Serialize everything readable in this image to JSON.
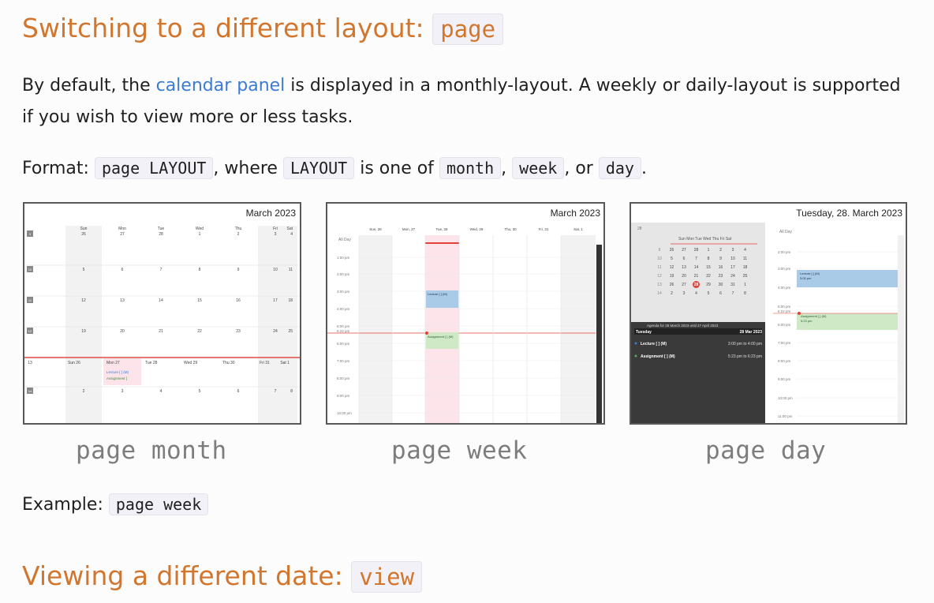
{
  "layout_section": {
    "heading_text": "Switching to a different layout:",
    "heading_code": "page"
  },
  "intro": {
    "before_link": "By default, the ",
    "link_text": "calendar panel",
    "after_link": " is displayed in a monthly-layout. A weekly or daily-layout is supported if you wish to view more or less tasks."
  },
  "format": {
    "label": "Format:",
    "command": "page LAYOUT",
    "mid1": ", where",
    "layout_word": "LAYOUT",
    "mid2": "is one of",
    "opt1": "month",
    "sep1": ",",
    "opt2": "week",
    "sep2": ", or",
    "opt3": "day",
    "end": "."
  },
  "screenshots": {
    "month": {
      "title": "March 2023",
      "caption": "page month",
      "weekdays": [
        "Sun",
        "Mon",
        "Tue",
        "Wed",
        "Thu",
        "Fri",
        "Sat"
      ],
      "weeks": [
        {
          "num": "9",
          "days": [
            "26",
            "27",
            "28",
            "1",
            "2",
            "3",
            "4"
          ]
        },
        {
          "num": "10",
          "days": [
            "5",
            "6",
            "7",
            "8",
            "9",
            "10",
            "11"
          ]
        },
        {
          "num": "11",
          "days": [
            "12",
            "13",
            "14",
            "15",
            "16",
            "17",
            "18"
          ]
        },
        {
          "num": "12",
          "days": [
            "19",
            "20",
            "21",
            "22",
            "23",
            "24",
            "25"
          ]
        },
        {
          "num": "13",
          "days": [
            "Sun 26",
            "Mon 27",
            "Tue 28",
            "Wed 29",
            "Thu 30",
            "Fri 31",
            "Sat 1"
          ]
        },
        {
          "num": "14",
          "days": [
            "2",
            "3",
            "4",
            "5",
            "6",
            "7",
            "8"
          ]
        }
      ],
      "events": [
        "Lecture [ ] (M)",
        "Assignment ["
      ]
    },
    "week": {
      "title": "March 2023",
      "caption": "page week",
      "days": [
        "Sun, 26",
        "Mon, 27",
        "Tue, 28",
        "Wed, 29",
        "Thu, 30",
        "Fri, 31",
        "Sat, 1"
      ],
      "allday": "All Day",
      "times": [
        "1:00 pm",
        "2:00 pm",
        "3:00 pm",
        "4:00 pm",
        "5:00 pm",
        "5:22 pm",
        "6:00 pm",
        "7:00 pm",
        "8:00 pm",
        "9:00 pm",
        "10:00 pm"
      ],
      "event1": "Lecture [ ] (M)",
      "event2": "Assignment [ ] (M)"
    },
    "day": {
      "title": "Tuesday, 28. March 2023",
      "caption": "page day",
      "allday": "All Day",
      "mini_month": "28",
      "mini_weekdays": "Sun Mon Tue Wed Thu Fri Sat",
      "mini_rows": [
        [
          "9",
          "26",
          "27",
          "28",
          "1",
          "2",
          "3",
          "4"
        ],
        [
          "10",
          "5",
          "6",
          "7",
          "8",
          "9",
          "10",
          "11"
        ],
        [
          "11",
          "12",
          "13",
          "14",
          "15",
          "16",
          "17",
          "18"
        ],
        [
          "12",
          "19",
          "20",
          "21",
          "22",
          "23",
          "24",
          "25"
        ],
        [
          "13",
          "26",
          "27",
          "28",
          "29",
          "30",
          "31",
          "1"
        ],
        [
          "14",
          "2",
          "3",
          "4",
          "5",
          "6",
          "7",
          "8"
        ]
      ],
      "agenda_header": "Agenda for 28 March 2023 until 27 April 2023",
      "agenda_day": "Tuesday",
      "agenda_date": "28 Mar 2023",
      "agenda_items": [
        {
          "name": "Lecture [ ] (M)",
          "time": "3:00 pm to 4:00 pm"
        },
        {
          "name": "Assignment [ ] (M)",
          "time": "5:23 pm to 6:23 pm"
        }
      ],
      "times": [
        "2:00 pm",
        "3:00 pm",
        "4:00 pm",
        "5:00 pm",
        "5:22 pm",
        "6:00 pm",
        "7:00 pm",
        "8:00 pm",
        "9:00 pm",
        "10:00 pm",
        "11:00 pm"
      ],
      "event1": "Lecture [ ] (M)",
      "event1_time": "3:00 pm",
      "event2": "Assignment [ ] (M)",
      "event2_time": "5:23 pm"
    }
  },
  "example": {
    "label": "Example:",
    "command": "page week"
  },
  "view_section": {
    "heading_text": "Viewing a different date:",
    "heading_code": "view"
  },
  "colors": {
    "heading": "#d2762e",
    "link": "#3b7bd3",
    "event_blue": "#a9cbe8",
    "event_green": "#cfe9c6",
    "today_red": "#e0433a"
  }
}
